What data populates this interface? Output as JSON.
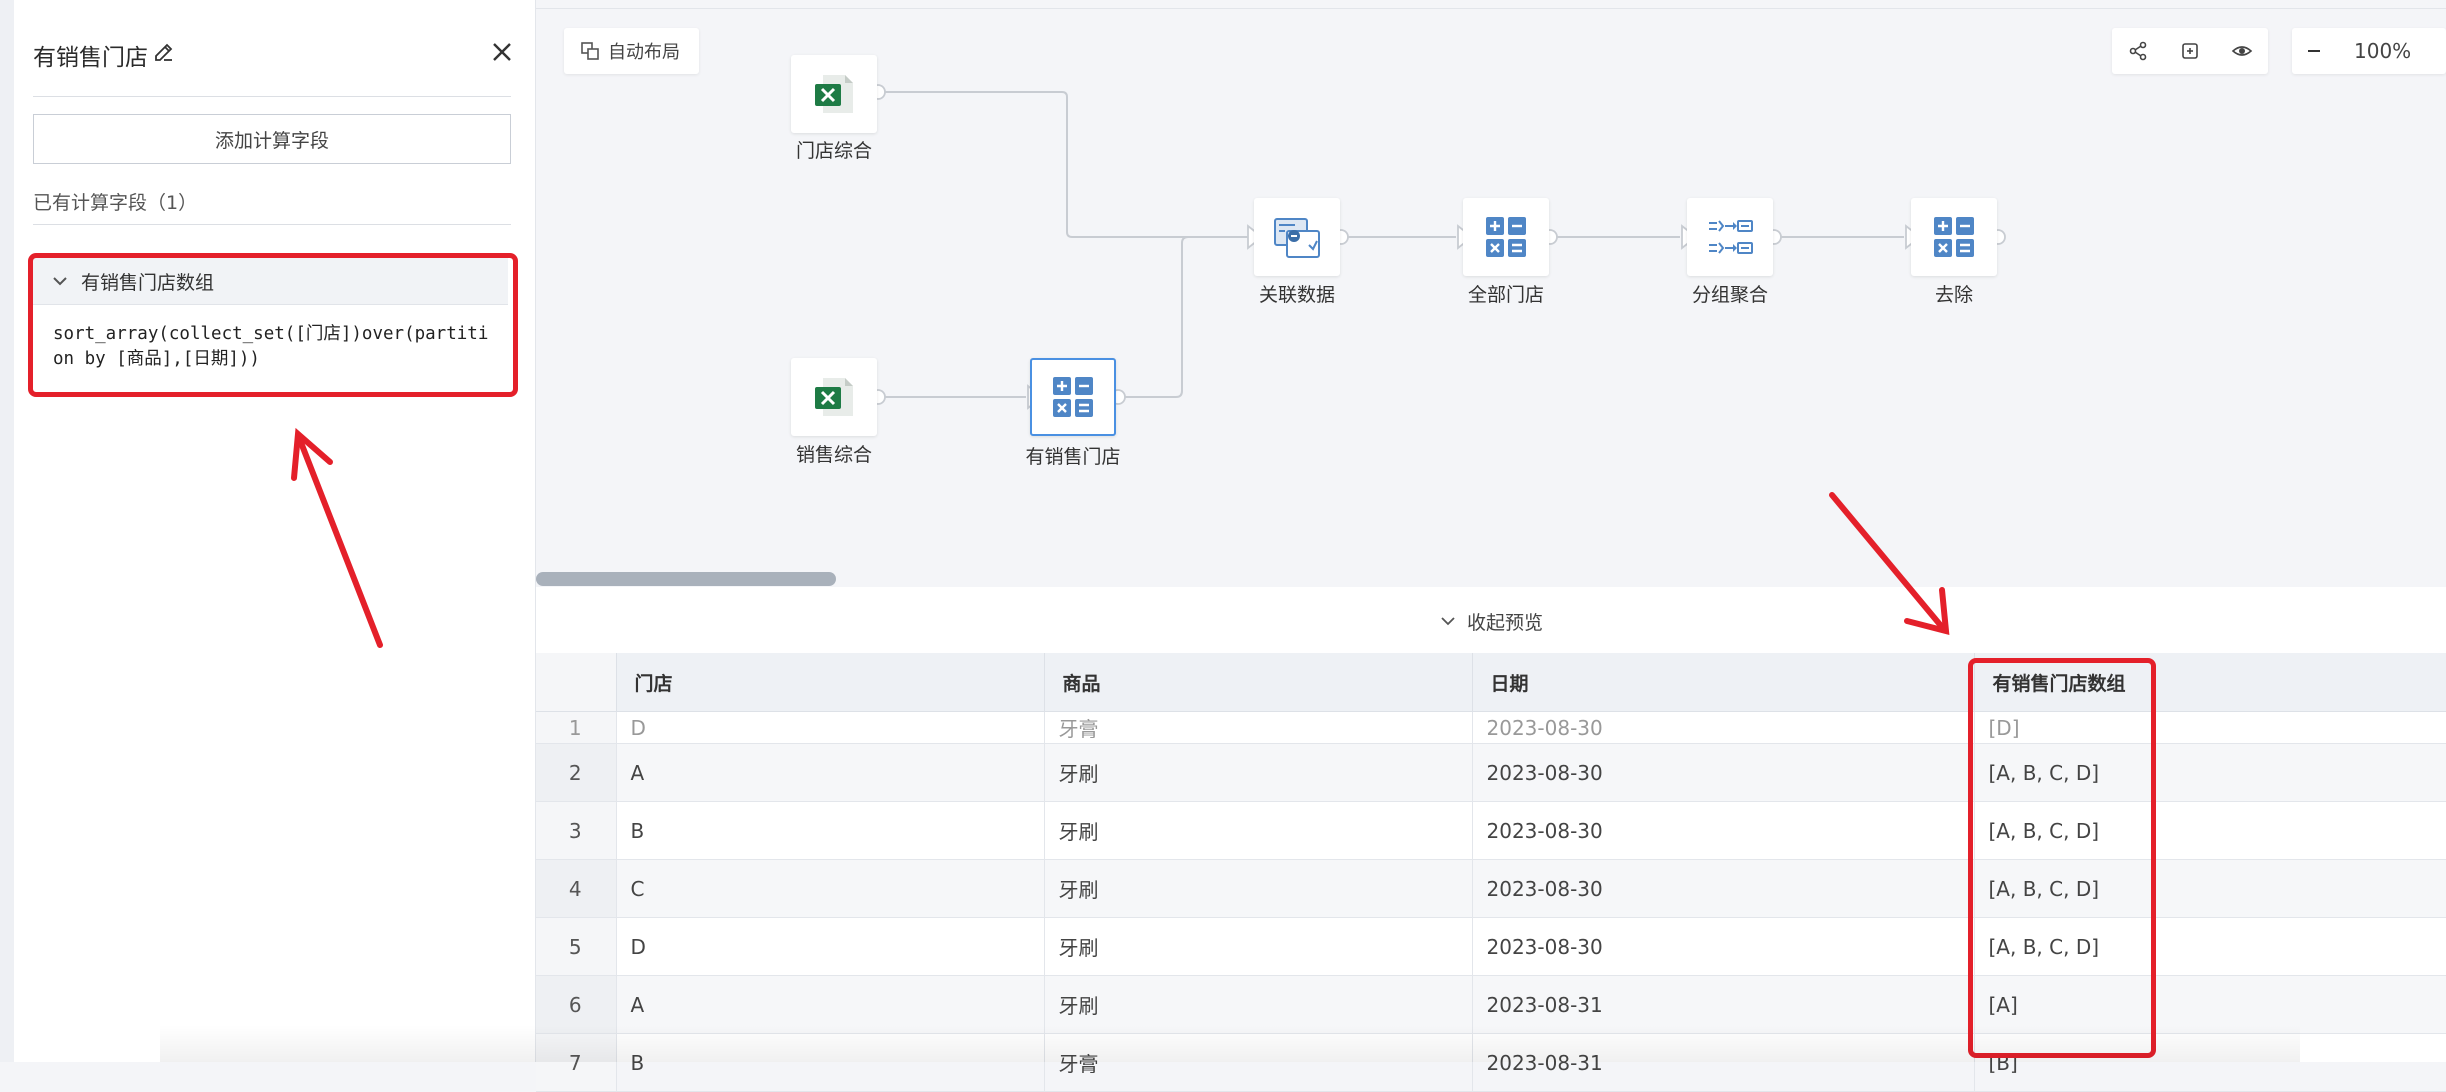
{
  "panel": {
    "title": "有销售门店",
    "add_button": "添加计算字段",
    "existing_label": "已有计算字段（1）",
    "field": {
      "name": "有销售门店数组",
      "expression": "sort_array(collect_set([门店])over(partition by [商品],[日期]))"
    }
  },
  "toolbar": {
    "auto_layout": "自动布局",
    "zoom": "100%"
  },
  "flow": {
    "nodes": [
      {
        "label": "门店综合",
        "icon": "excel-icon"
      },
      {
        "label": "销售综合",
        "icon": "excel-icon"
      },
      {
        "label": "有销售门店",
        "icon": "calculator-icon"
      },
      {
        "label": "关联数据",
        "icon": "join-icon"
      },
      {
        "label": "全部门店",
        "icon": "calculator-icon"
      },
      {
        "label": "分组聚合",
        "icon": "group-aggregate-icon"
      },
      {
        "label": "去除",
        "icon": "calculator-icon"
      }
    ]
  },
  "preview": {
    "collapse_label": "收起预览",
    "columns": [
      "门店",
      "商品",
      "日期",
      "有销售门店数组"
    ],
    "partial_row": [
      "1",
      "D",
      "牙膏",
      "2023-08-30",
      "[D]"
    ],
    "rows": [
      [
        "2",
        "A",
        "牙刷",
        "2023-08-30",
        "[A, B, C, D]"
      ],
      [
        "3",
        "B",
        "牙刷",
        "2023-08-30",
        "[A, B, C, D]"
      ],
      [
        "4",
        "C",
        "牙刷",
        "2023-08-30",
        "[A, B, C, D]"
      ],
      [
        "5",
        "D",
        "牙刷",
        "2023-08-30",
        "[A, B, C, D]"
      ],
      [
        "6",
        "A",
        "牙刷",
        "2023-08-31",
        "[A]"
      ],
      [
        "7",
        "B",
        "牙膏",
        "2023-08-31",
        "[B]"
      ]
    ]
  },
  "colors": {
    "annotation_red": "#e4202a",
    "selected_blue": "#4a90e2",
    "excel_green": "#1e7b45",
    "calc_blue": "#4f86c6"
  }
}
